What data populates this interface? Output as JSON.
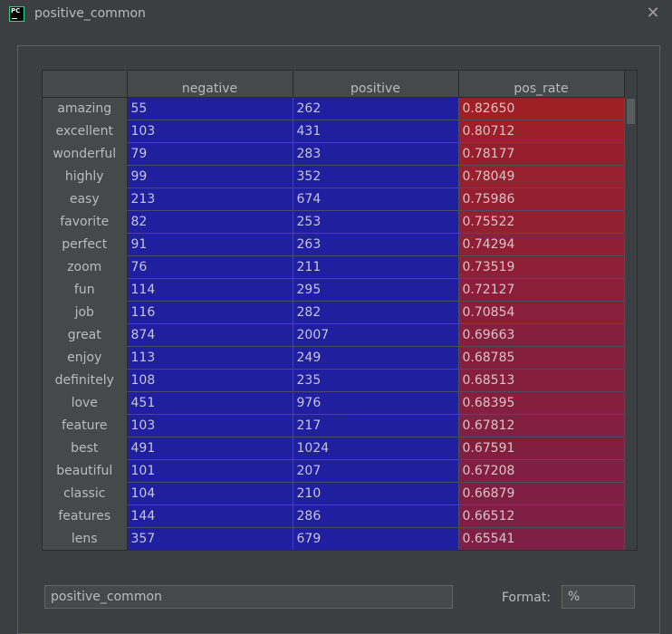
{
  "window": {
    "title": "positive_common",
    "app_icon_text": "PC",
    "close_icon": "close-icon"
  },
  "table": {
    "columns": [
      "",
      "negative",
      "positive",
      "pos_rate"
    ],
    "rows": [
      {
        "label": "amazing",
        "negative": "55",
        "positive": "262",
        "pos_rate": "0.82650"
      },
      {
        "label": "excellent",
        "negative": "103",
        "positive": "431",
        "pos_rate": "0.80712"
      },
      {
        "label": "wonderful",
        "negative": "79",
        "positive": "283",
        "pos_rate": "0.78177"
      },
      {
        "label": "highly",
        "negative": "99",
        "positive": "352",
        "pos_rate": "0.78049"
      },
      {
        "label": "easy",
        "negative": "213",
        "positive": "674",
        "pos_rate": "0.75986"
      },
      {
        "label": "favorite",
        "negative": "82",
        "positive": "253",
        "pos_rate": "0.75522"
      },
      {
        "label": "perfect",
        "negative": "91",
        "positive": "263",
        "pos_rate": "0.74294"
      },
      {
        "label": "zoom",
        "negative": "76",
        "positive": "211",
        "pos_rate": "0.73519"
      },
      {
        "label": "fun",
        "negative": "114",
        "positive": "295",
        "pos_rate": "0.72127"
      },
      {
        "label": "job",
        "negative": "116",
        "positive": "282",
        "pos_rate": "0.70854"
      },
      {
        "label": "great",
        "negative": "874",
        "positive": "2007",
        "pos_rate": "0.69663"
      },
      {
        "label": "enjoy",
        "negative": "113",
        "positive": "249",
        "pos_rate": "0.68785"
      },
      {
        "label": "definitely",
        "negative": "108",
        "positive": "235",
        "pos_rate": "0.68513"
      },
      {
        "label": "love",
        "negative": "451",
        "positive": "976",
        "pos_rate": "0.68395"
      },
      {
        "label": "feature",
        "negative": "103",
        "positive": "217",
        "pos_rate": "0.67812"
      },
      {
        "label": "best",
        "negative": "491",
        "positive": "1024",
        "pos_rate": "0.67591"
      },
      {
        "label": "beautiful",
        "negative": "101",
        "positive": "207",
        "pos_rate": "0.67208"
      },
      {
        "label": "classic",
        "negative": "104",
        "positive": "210",
        "pos_rate": "0.66879"
      },
      {
        "label": "features",
        "negative": "144",
        "positive": "286",
        "pos_rate": "0.66512"
      },
      {
        "label": "lens",
        "negative": "357",
        "positive": "679",
        "pos_rate": "0.65541"
      }
    ]
  },
  "colors": {
    "background": "#3c3f41",
    "cell_blue": "#1f1f9f",
    "rate_high": "#a01f25",
    "rate_low": "#7e1f45"
  },
  "footer": {
    "name_value": "positive_common",
    "format_label": "Format:",
    "format_value": "%"
  }
}
